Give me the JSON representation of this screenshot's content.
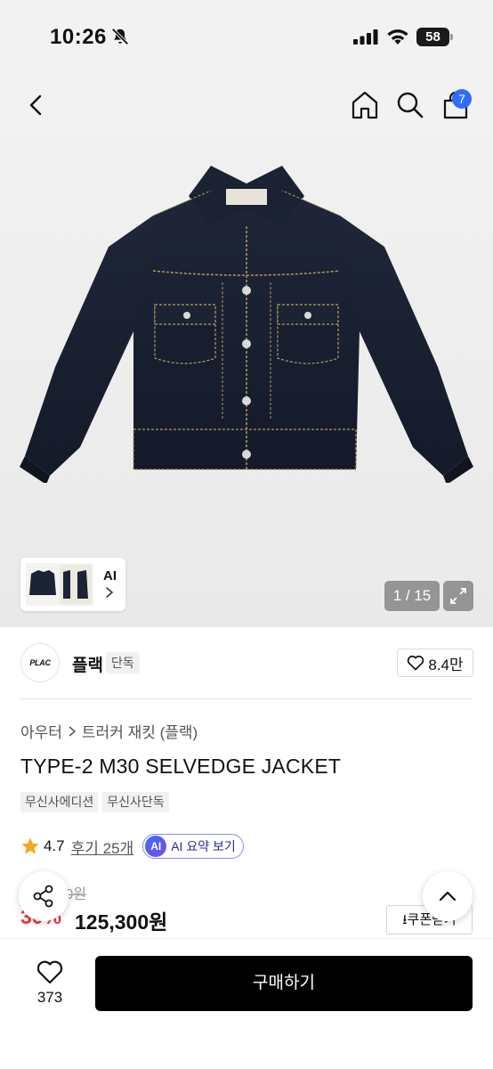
{
  "status_bar": {
    "time": "10:26",
    "battery": "58"
  },
  "nav": {
    "cart_count": "7"
  },
  "gallery": {
    "ai_label": "AI",
    "counter": "1 / 15"
  },
  "brand": {
    "logo_text": "PLAC",
    "name": "플랙",
    "tag": "단독",
    "likes": "8.4만"
  },
  "product": {
    "breadcrumb": [
      "아우터",
      "트러커 재킷 (플랙)"
    ],
    "title": "TYPE-2 M30 SELVEDGE JACKET",
    "tags": [
      "무신사에디션",
      "무신사단독"
    ],
    "rating": "4.7",
    "reviews": "후기 25개",
    "ai_summary": "AI 요약 보기",
    "ai_badge": "AI"
  },
  "price": {
    "original": "1 0원",
    "discount": "30%",
    "final": "125,300원",
    "coupon_label": "쿠폰받기"
  },
  "bottom": {
    "wish_count": "373",
    "buy_label": "구매하기"
  },
  "colors": {
    "accent_blue": "#2f6df6",
    "sale_red": "#f0343b",
    "denim": "#1c2335"
  }
}
